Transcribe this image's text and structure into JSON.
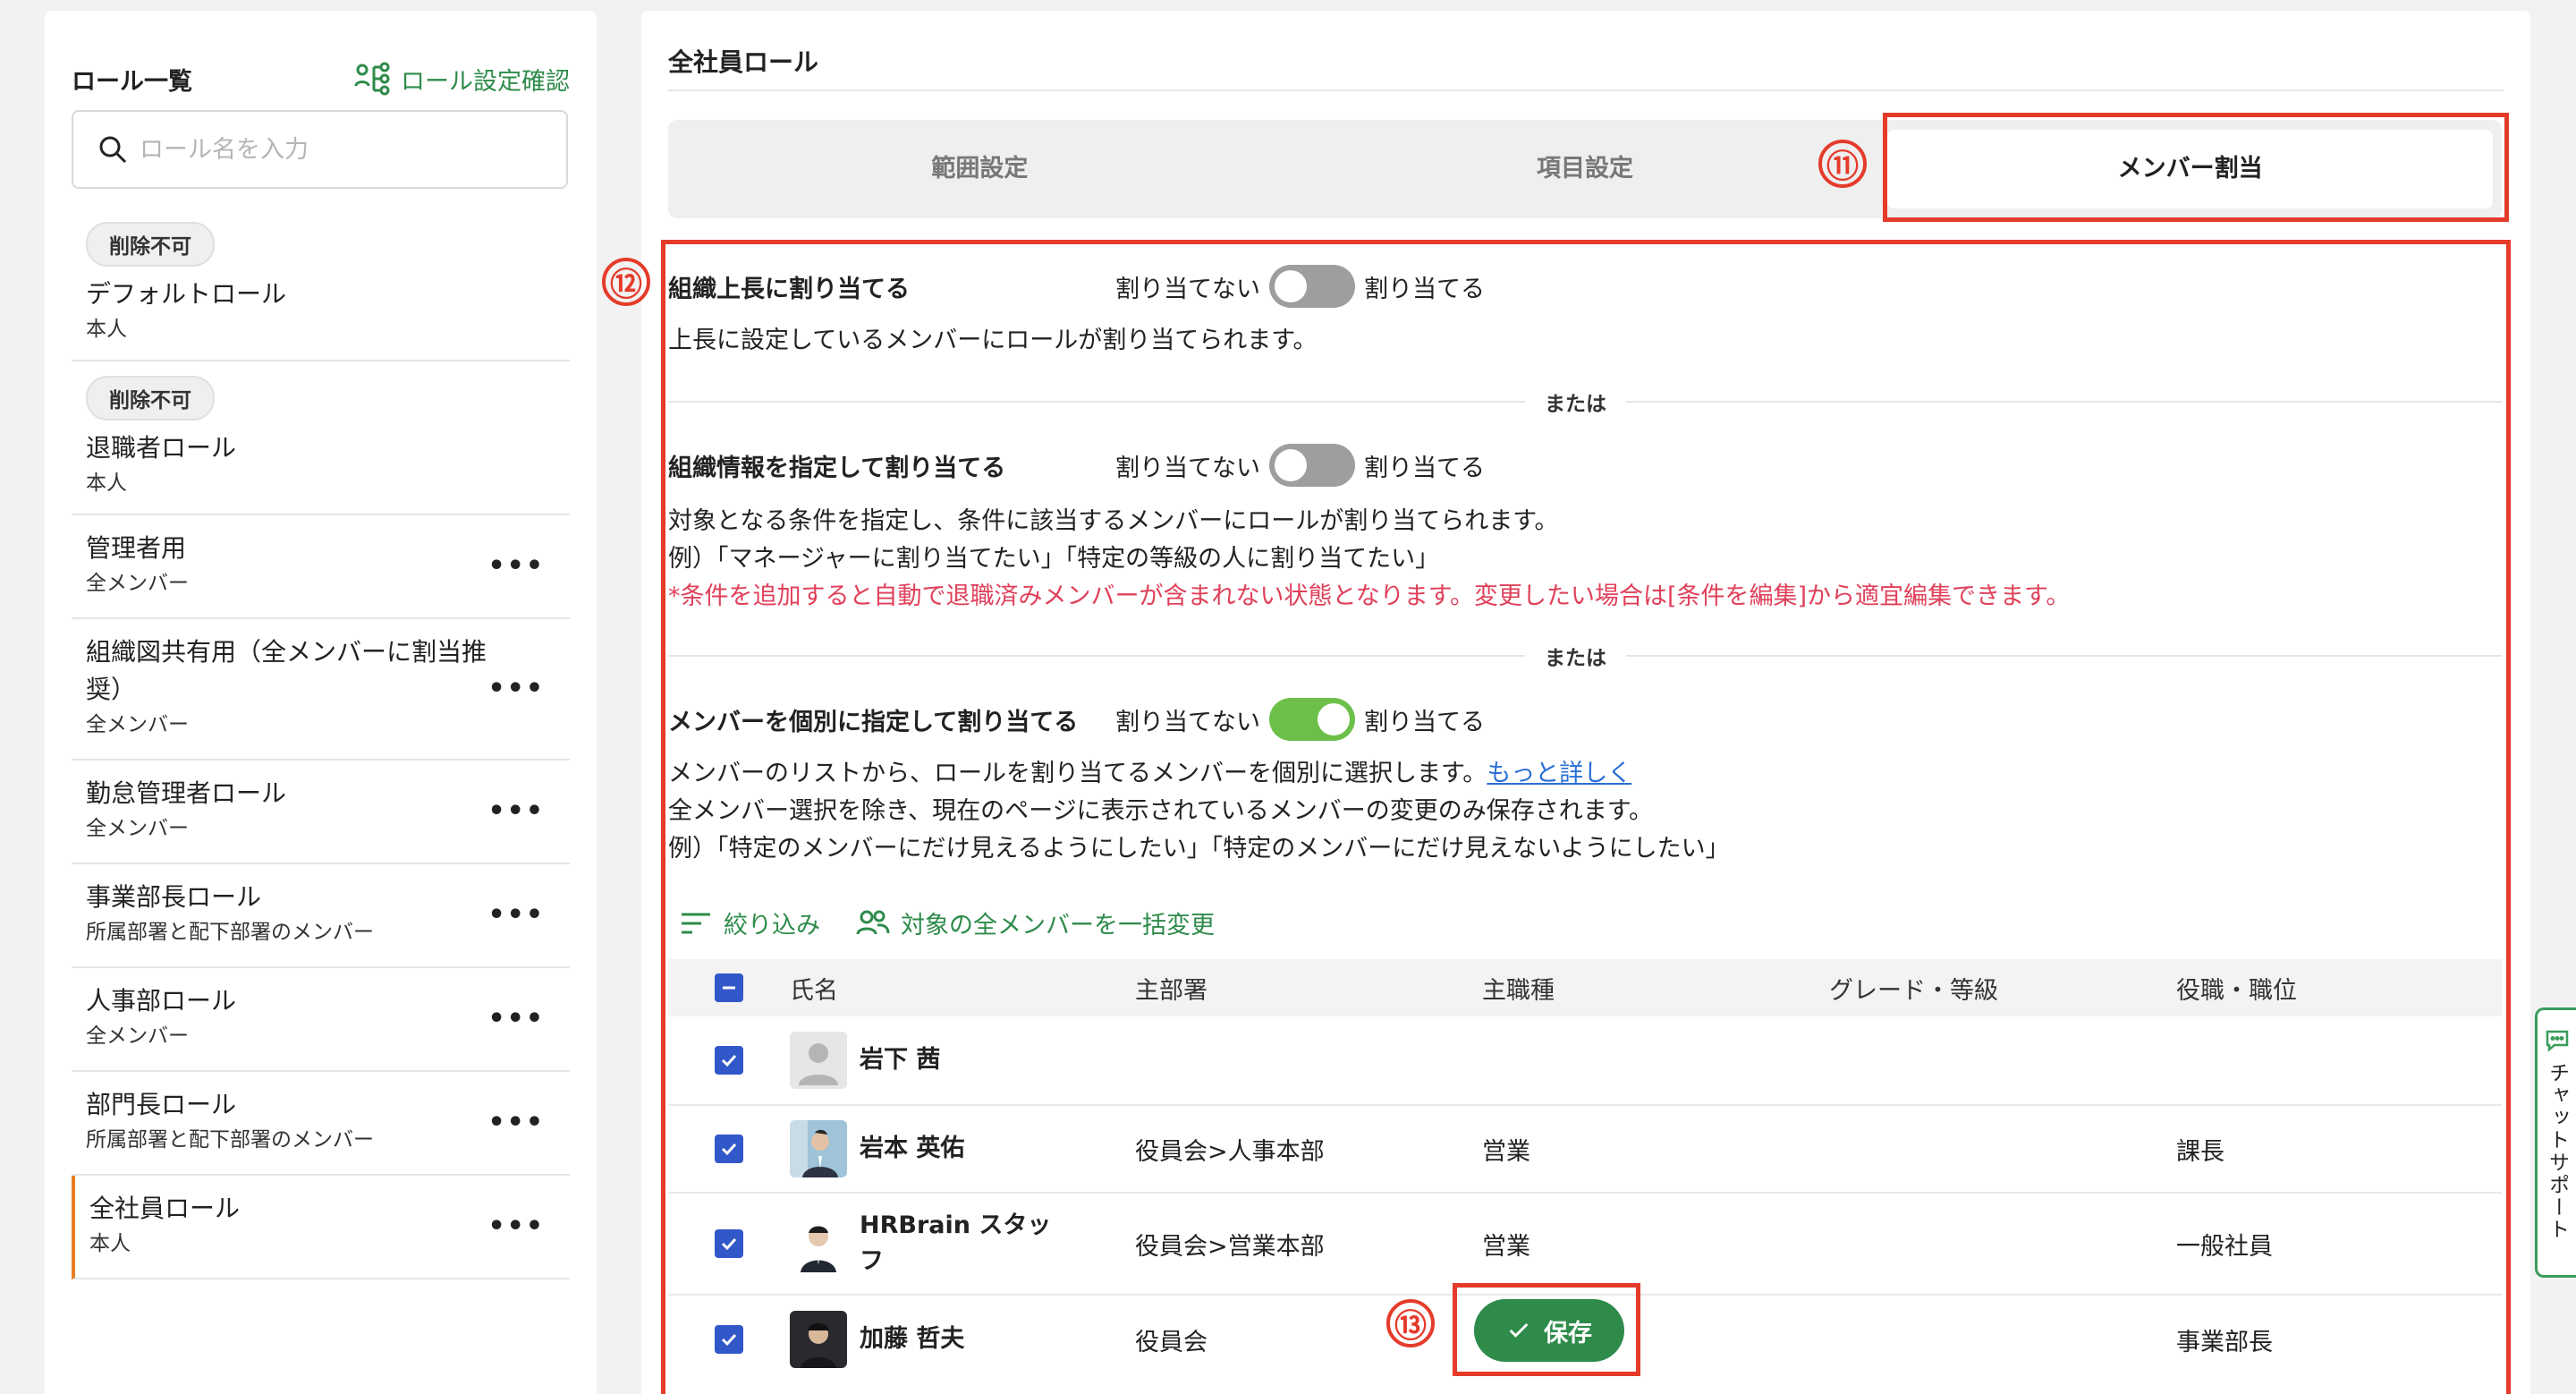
{
  "left": {
    "title": "ロール一覧",
    "role_check_link": "ロール設定確認",
    "search_placeholder": "ロール名を入力",
    "roles": [
      {
        "badge": "削除不可",
        "name": "デフォルトロール",
        "scope": "本人"
      },
      {
        "badge": "削除不可",
        "name": "退職者ロール",
        "scope": "本人"
      },
      {
        "name": "管理者用",
        "scope": "全メンバー",
        "more": "•••"
      },
      {
        "name": "組織図共有用（全メンバーに割当推奨）",
        "scope": "全メンバー",
        "more": "•••"
      },
      {
        "name": "勤怠管理者ロール",
        "scope": "全メンバー",
        "more": "•••"
      },
      {
        "name": "事業部長ロール",
        "scope": "所属部署と配下部署のメンバー",
        "more": "•••"
      },
      {
        "name": "人事部ロール",
        "scope": "全メンバー",
        "more": "•••"
      },
      {
        "name": "部門長ロール",
        "scope": "所属部署と配下部署のメンバー",
        "more": "•••"
      },
      {
        "name": "全社員ロール",
        "scope": "本人",
        "more": "•••"
      }
    ]
  },
  "main": {
    "title": "全社員ロール",
    "tabs": [
      "範囲設定",
      "項目設定",
      "メンバー割当"
    ],
    "annotations": {
      "n11": "⑪",
      "n12": "⑫",
      "n13": "⑬"
    },
    "toggle_off_label": "割り当てない",
    "toggle_on_label": "割り当てる",
    "or_label": "または",
    "section1": {
      "title": "組織上長に割り当てる",
      "desc": "上長に設定しているメンバーにロールが割り当てられます。"
    },
    "section2": {
      "title": "組織情報を指定して割り当てる",
      "desc1": "対象となる条件を指定し、条件に該当するメンバーにロールが割り当てられます。",
      "desc2": "例）「マネージャーに割り当てたい」「特定の等級の人に割り当てたい」",
      "warning": "*条件を追加すると自動で退職済みメンバーが含まれない状態となります。変更したい場合は[条件を編集]から適宜編集できます。"
    },
    "section3": {
      "title": "メンバーを個別に指定して割り当てる",
      "desc1": "メンバーのリストから、ロールを割り当てるメンバーを個別に選択します。",
      "more_link": "もっと詳しく",
      "desc2": "全メンバー選択を除き、現在のページに表示されているメンバーの変更のみ保存されます。",
      "desc3": "例）「特定のメンバーにだけ見えるようにしたい」「特定のメンバーにだけ見えないようにしたい」"
    },
    "actions": {
      "filter": "絞り込み",
      "bulk_change": "対象の全メンバーを一括変更"
    },
    "table": {
      "headers": [
        "氏名",
        "主部署",
        "主職種",
        "グレード・等級",
        "役職・職位"
      ],
      "rows": [
        {
          "name": "岩下 茜",
          "dept": "",
          "job": "",
          "grade": "",
          "position": ""
        },
        {
          "name": "岩本 英佑",
          "dept": "役員会>人事本部",
          "job": "営業",
          "grade": "",
          "position": "課長"
        },
        {
          "name": "HRBrain スタッフ",
          "dept": "役員会>営業本部",
          "job": "営業",
          "grade": "",
          "position": "一般社員"
        },
        {
          "name": "加藤 哲夫",
          "dept": "役員会",
          "job": "",
          "grade": "",
          "position": "事業部長"
        }
      ]
    },
    "save_label": "保存"
  },
  "chat_support": "チャットサポート",
  "colors": {
    "accent_green": "#2e8b4a",
    "annotation_red": "#e53b2b",
    "checkbox_blue": "#3257c9",
    "toggle_on": "#6cc04a",
    "warning_red": "#e0405a"
  }
}
